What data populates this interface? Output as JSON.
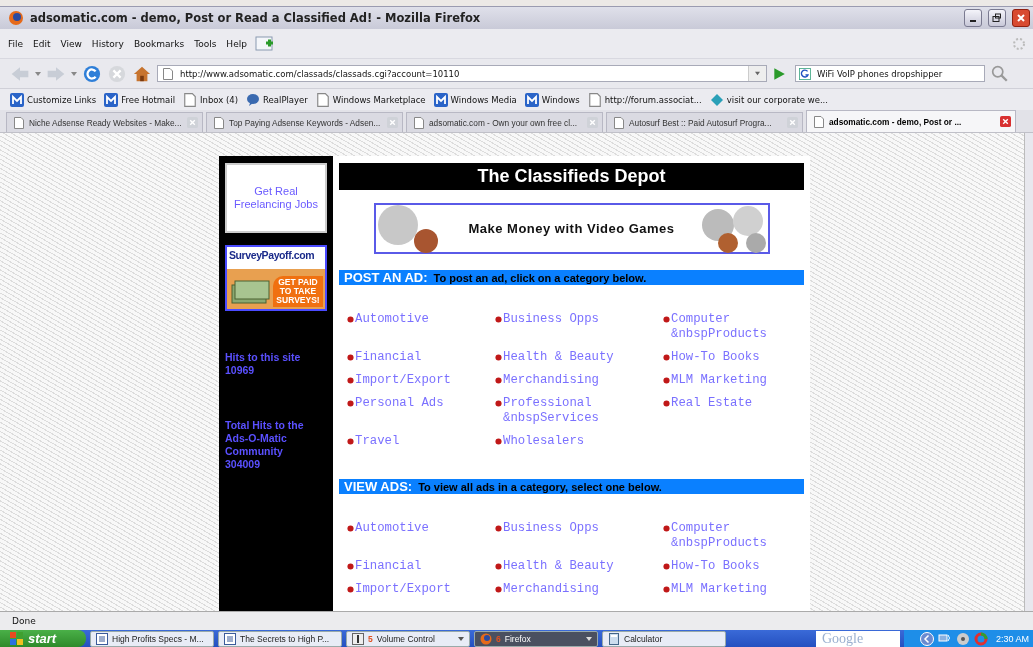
{
  "window": {
    "title": "adsomatic.com - demo, Post or Read a Classified Ad! - Mozilla Firefox"
  },
  "menu": [
    "File",
    "Edit",
    "View",
    "History",
    "Bookmarks",
    "Tools",
    "Help"
  ],
  "address": {
    "value": "http://www.adsomatic.com/classads/classads.cgi?account=10110"
  },
  "search": {
    "value": "WiFi VoIP phones dropshipper"
  },
  "bookmarks": [
    {
      "label": "Customize Links",
      "kind": "m"
    },
    {
      "label": "Free Hotmail",
      "kind": "m"
    },
    {
      "label": "Inbox (4)",
      "kind": "page"
    },
    {
      "label": "RealPlayer",
      "kind": "bubble"
    },
    {
      "label": "Windows Marketplace",
      "kind": "page"
    },
    {
      "label": "Windows Media",
      "kind": "m"
    },
    {
      "label": "Windows",
      "kind": "m"
    },
    {
      "label": "http://forum.associat...",
      "kind": "page"
    },
    {
      "label": "visit our corporate we...",
      "kind": "diamond"
    }
  ],
  "tabs": [
    {
      "label": "Niche Adsense Ready Websites - Make...",
      "selected": false
    },
    {
      "label": "Top Paying Adsense Keywords - Adsen...",
      "selected": false
    },
    {
      "label": "adsomatic.com - Own your own free cl...",
      "selected": false
    },
    {
      "label": "Autosurf Best :: Paid Autosurf Progra...",
      "selected": false
    },
    {
      "label": "adsomatic.com - demo, Post or ...",
      "selected": true
    }
  ],
  "sidebar": {
    "ad_link": "Get Real Freelancing Jobs",
    "banner": {
      "title": "SurveyPayoff.com",
      "slogan": "GET PAID TO TAKE SURVEYS!"
    },
    "hits_label": "Hits to this site",
    "hits": "10969",
    "total_label": "Total Hits to the Ads-O-Matic Community",
    "total": "304009"
  },
  "header": "The Classifieds Depot",
  "banner": "Make Money with Video Games",
  "sections": [
    {
      "title": "POST AN AD:",
      "hint": "To post an ad, click on a category below.",
      "categories": [
        "Automotive",
        "Business Opps",
        "Computer &nbspProducts",
        "Financial",
        "Health & Beauty",
        "How-To Books",
        "Import/Export",
        "Merchandising",
        "MLM Marketing",
        "Personal Ads",
        "Professional &nbspServices",
        "Real Estate",
        "Travel",
        "Wholesalers"
      ]
    },
    {
      "title": "VIEW ADS:",
      "hint": "To view all ads in a category, select one below.",
      "categories": [
        "Automotive",
        "Business Opps",
        "Computer &nbspProducts",
        "Financial",
        "Health & Beauty",
        "How-To Books",
        "Import/Export",
        "Merchandising",
        "MLM Marketing"
      ]
    }
  ],
  "status_bar": "Done",
  "taskbar": {
    "start": "start",
    "items": [
      {
        "label": "High Profits Specs - M...",
        "selected": false,
        "kind": "doc"
      },
      {
        "label": "The Secrets to High P...",
        "selected": false,
        "kind": "doc"
      },
      {
        "label": "Volume Control",
        "count": "5",
        "selected": false,
        "kind": "app"
      },
      {
        "label": "Firefox",
        "count": "6",
        "selected": true,
        "kind": "fox"
      },
      {
        "label": "Calculator",
        "selected": false,
        "kind": "calc"
      }
    ],
    "search_placeholder": "Google",
    "clock": "2:30 AM"
  }
}
